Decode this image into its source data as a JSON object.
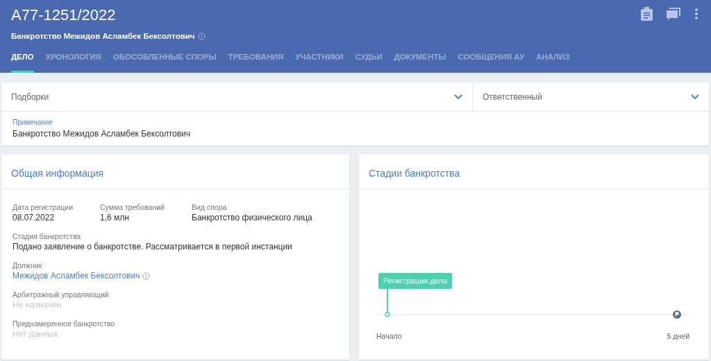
{
  "header": {
    "case_number": "А77-1251/2022",
    "subtitle": "Банкротство Межидов Асламбек Бексолтович"
  },
  "tabs": [
    {
      "label": "ДЕЛО",
      "selected": true
    },
    {
      "label": "ХРОНОЛОГИЯ",
      "selected": false
    },
    {
      "label": "ОБОСОБЛЕННЫЕ СПОРЫ",
      "selected": false
    },
    {
      "label": "ТРЕБОВАНИЯ",
      "selected": false
    },
    {
      "label": "УЧАСТНИКИ",
      "selected": false
    },
    {
      "label": "СУДЬИ",
      "selected": false
    },
    {
      "label": "ДОКУМЕНТЫ",
      "selected": false
    },
    {
      "label": "СООБЩЕНИЯ АУ",
      "selected": false
    },
    {
      "label": "АНАЛИЗ",
      "selected": false
    }
  ],
  "filters": [
    {
      "placeholder": "Подборки"
    },
    {
      "placeholder": "Ответственный"
    }
  ],
  "note": {
    "label": "Примечание",
    "value": "Банкротство Межидов Асламбек Бексолтович"
  },
  "general_info": {
    "title": "Общая информация",
    "rows": [
      [
        {
          "label": "Дата регистрации",
          "value": "08.07.2022",
          "kind": "plain"
        },
        {
          "label": "Сумма требований",
          "value": "1,6 млн",
          "kind": "plain"
        },
        {
          "label": "Вид спора",
          "value": "Банкротство физического лица",
          "kind": "plain"
        }
      ],
      [
        {
          "label": "Стадия банкротства",
          "value": "Подано заявление о банкротстве. Рассматривается в первой инстанции",
          "kind": "plain"
        }
      ],
      [
        {
          "label": "Должник",
          "value": "Межидов Асламбек Бексолтович",
          "kind": "link"
        }
      ],
      [
        {
          "label": "Арбитражный управляющий",
          "value": "Не назначен",
          "kind": "muted"
        }
      ],
      [
        {
          "label": "Преднамеренное банкротство",
          "value": "Нет данных",
          "kind": "muted"
        }
      ]
    ]
  },
  "stages": {
    "title": "Стадии банкротства",
    "event": "Регистрация дела",
    "start_label": "Начало",
    "end_label": "5 дней"
  }
}
